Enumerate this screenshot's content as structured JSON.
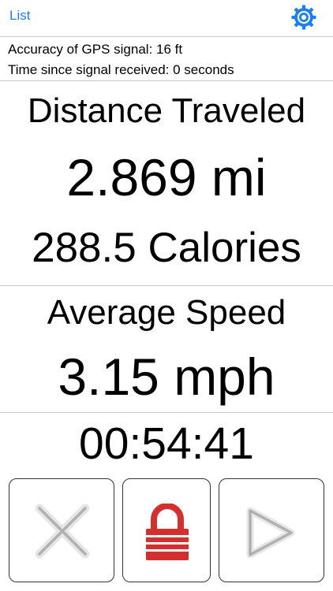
{
  "nav": {
    "list_label": "List",
    "settings_icon": "gear-icon",
    "accent_color": "#1a7ff5"
  },
  "status": {
    "gps_accuracy": "Accuracy of GPS signal: 16 ft",
    "signal_time": "Time since signal received: 0 seconds"
  },
  "distance": {
    "label": "Distance Traveled",
    "value": "2.869 mi",
    "calories": "288.5 Calories"
  },
  "speed": {
    "label": "Average Speed",
    "value": "3.15 mph"
  },
  "timer": {
    "value": "00:54:41"
  },
  "controls": {
    "cancel_icon": "close-icon",
    "lock_icon": "lock-icon",
    "lock_color": "#d32f2f",
    "play_icon": "play-icon"
  }
}
